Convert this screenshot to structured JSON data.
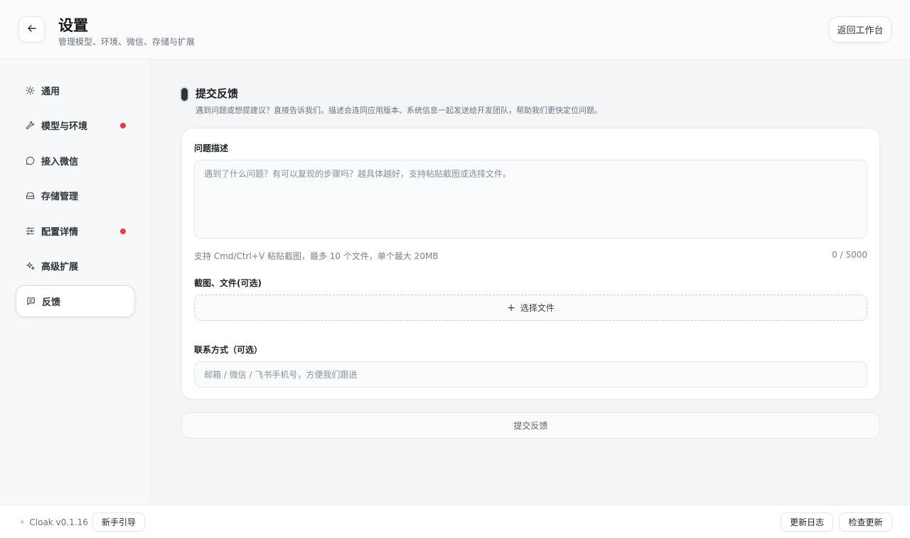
{
  "header": {
    "title": "设置",
    "subtitle": "管理模型、环境、微信、存储与扩展",
    "return_label": "返回工作台"
  },
  "sidebar": {
    "items": [
      {
        "label": "通用",
        "icon": "sun-icon",
        "badge": false,
        "active": false
      },
      {
        "label": "模型与环境",
        "icon": "wrench-icon",
        "badge": true,
        "active": false
      },
      {
        "label": "接入微信",
        "icon": "chat-bubble-icon",
        "badge": false,
        "active": false
      },
      {
        "label": "存储管理",
        "icon": "drive-icon",
        "badge": false,
        "active": false
      },
      {
        "label": "配置详情",
        "icon": "sliders-icon",
        "badge": true,
        "active": false
      },
      {
        "label": "高级扩展",
        "icon": "sparkles-icon",
        "badge": false,
        "active": false
      },
      {
        "label": "反馈",
        "icon": "message-square-icon",
        "badge": false,
        "active": true
      }
    ],
    "badge_color": "#ef3a44"
  },
  "feedback": {
    "title": "提交反馈",
    "description": "遇到问题或想提建议？直接告诉我们。描述会连同应用版本、系统信息一起发送给开发团队，帮助我们更快定位问题。",
    "problem_label": "问题描述",
    "problem_placeholder": "遇到了什么问题？有可以复现的步骤吗？越具体越好，支持粘贴截图或选择文件。",
    "hint": "支持 Cmd/Ctrl+V 粘贴截图，最多 10 个文件，单个最大 20MB",
    "counter": "0 / 5000",
    "attachments_label": "截图、文件(可选)",
    "choose_file_label": "选择文件",
    "contact_label": "联系方式（可选）",
    "contact_placeholder": "邮箱 / 微信 / 飞书手机号，方便我们跟进",
    "submit_label": "提交反馈"
  },
  "footer": {
    "version": "Cloak v0.1.16",
    "guide_label": "新手引导",
    "changelog_label": "更新日志",
    "check_update_label": "检查更新"
  }
}
